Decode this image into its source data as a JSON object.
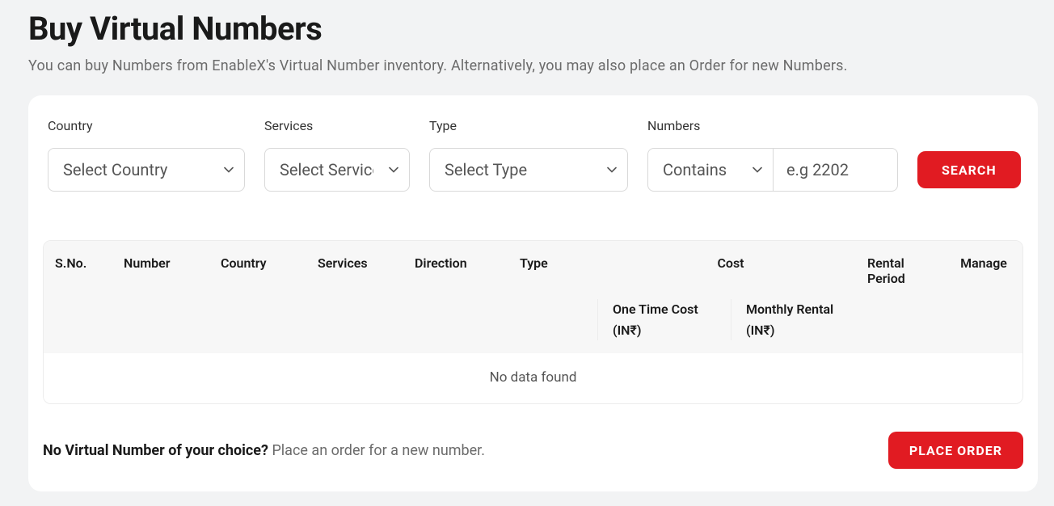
{
  "header": {
    "title": "Buy Virtual Numbers",
    "subtitle": "You can buy Numbers from EnableX's Virtual Number inventory. Alternatively, you may also place an Order for new Numbers."
  },
  "filters": {
    "country": {
      "label": "Country",
      "selected": "Select Country"
    },
    "services": {
      "label": "Services",
      "selected": "Select Services"
    },
    "type": {
      "label": "Type",
      "selected": "Select Type"
    },
    "numbers": {
      "label": "Numbers",
      "match_selected": "Contains",
      "placeholder": "e.g 2202"
    },
    "search_label": "SEARCH"
  },
  "table": {
    "columns": {
      "sno": "S.No.",
      "number": "Number",
      "country": "Country",
      "services": "Services",
      "direction": "Direction",
      "type": "Type",
      "cost": "Cost",
      "rental_period": "Rental Period",
      "manage": "Manage",
      "cost_onetime": "One Time Cost (IN₹)",
      "cost_monthly": "Monthly Rental (IN₹)"
    },
    "empty": "No data found"
  },
  "footer": {
    "bold": "No Virtual Number of your choice? ",
    "rest": "Place an order for a new number.",
    "button": "PLACE ORDER"
  }
}
